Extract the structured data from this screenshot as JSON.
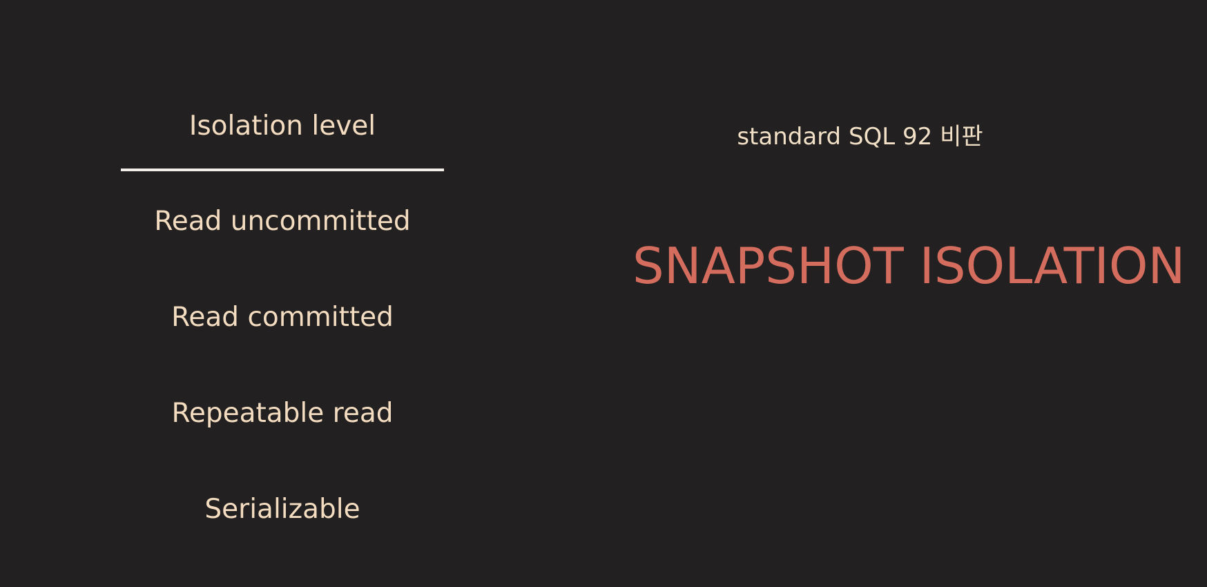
{
  "left": {
    "heading": "Isolation level",
    "levels": [
      "Read uncommitted",
      "Read committed",
      "Repeatable read",
      "Serializable"
    ]
  },
  "right": {
    "subtitle": "standard SQL 92 비판",
    "title": "SNAPSHOT ISOLATION"
  },
  "colors": {
    "background": "#222021",
    "text": "#f3dcc0",
    "divider": "#f4eee8",
    "accent": "#d56d5f"
  }
}
